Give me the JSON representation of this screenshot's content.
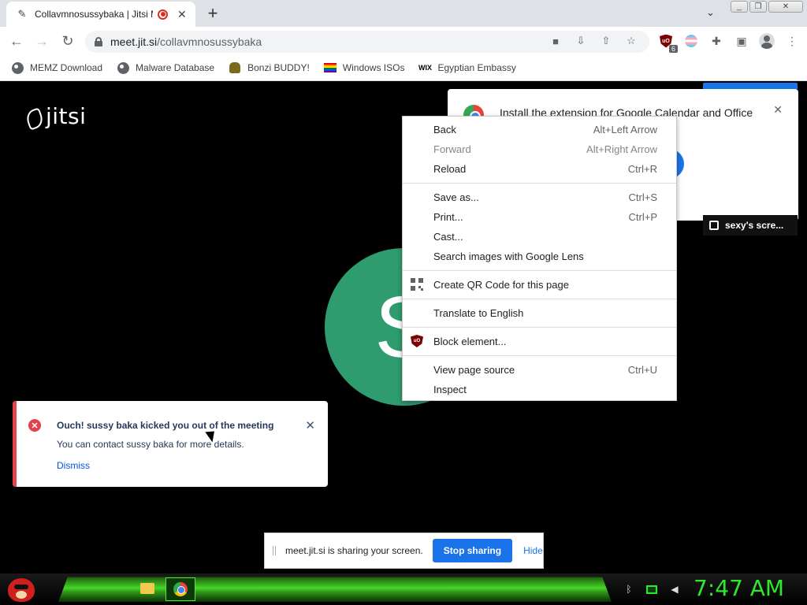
{
  "browser": {
    "tab": {
      "title": "Collavmnosussybaka | Jitsi Meet",
      "close": "✕"
    },
    "new_tab": "+",
    "url_host": "meet.jit.si",
    "url_path": "/collavmnosussybaka",
    "ublock_badge": "6",
    "bookmarks": [
      {
        "label": "MEMZ Download",
        "icon": "globe-icon"
      },
      {
        "label": "Malware Database",
        "icon": "globe-icon"
      },
      {
        "label": "Bonzi BUDDY!",
        "icon": "bonzi-icon"
      },
      {
        "label": "Windows ISOs",
        "icon": "rainbow-flag-icon"
      },
      {
        "label": "Egyptian Embassy",
        "icon": "wix-icon",
        "icon_text": "WIX"
      }
    ]
  },
  "jitsi": {
    "logo_text": "jitsi",
    "avatar_letter": "S",
    "calendar_promo": "Install the extension for Google Calendar and Office",
    "screen_label": "sexy's scre..."
  },
  "context_menu": {
    "groups": [
      [
        {
          "label": "Back",
          "shortcut": "Alt+Left Arrow",
          "enabled": true
        },
        {
          "label": "Forward",
          "shortcut": "Alt+Right Arrow",
          "enabled": false
        },
        {
          "label": "Reload",
          "shortcut": "Ctrl+R",
          "enabled": true
        }
      ],
      [
        {
          "label": "Save as...",
          "shortcut": "Ctrl+S",
          "enabled": true
        },
        {
          "label": "Print...",
          "shortcut": "Ctrl+P",
          "enabled": true
        },
        {
          "label": "Cast...",
          "shortcut": "",
          "enabled": true
        },
        {
          "label": "Search images with Google Lens",
          "shortcut": "",
          "enabled": true
        }
      ],
      [
        {
          "label": "Create QR Code for this page",
          "shortcut": "",
          "enabled": true,
          "icon": "qr-code-icon"
        }
      ],
      [
        {
          "label": "Translate to English",
          "shortcut": "",
          "enabled": true
        }
      ],
      [
        {
          "label": "Block element...",
          "shortcut": "",
          "enabled": true,
          "icon": "ublock-icon"
        }
      ],
      [
        {
          "label": "View page source",
          "shortcut": "Ctrl+U",
          "enabled": true
        },
        {
          "label": "Inspect",
          "shortcut": "",
          "enabled": true
        }
      ]
    ]
  },
  "notification": {
    "icon": "✕",
    "title": "Ouch! sussy baka kicked you out of the meeting",
    "description": "You can contact sussy baka for more details.",
    "dismiss": "Dismiss",
    "close": "✕"
  },
  "share_bar": {
    "text": "meet.jit.si is sharing your screen.",
    "stop": "Stop sharing",
    "hide": "Hide"
  },
  "taskbar": {
    "clock": "7:47 AM"
  },
  "colors": {
    "jitsi_avatar": "#2e9c6e",
    "error_red": "#e3414b",
    "chrome_blue": "#1a73e8",
    "taskbar_green": "#2ee82e"
  }
}
